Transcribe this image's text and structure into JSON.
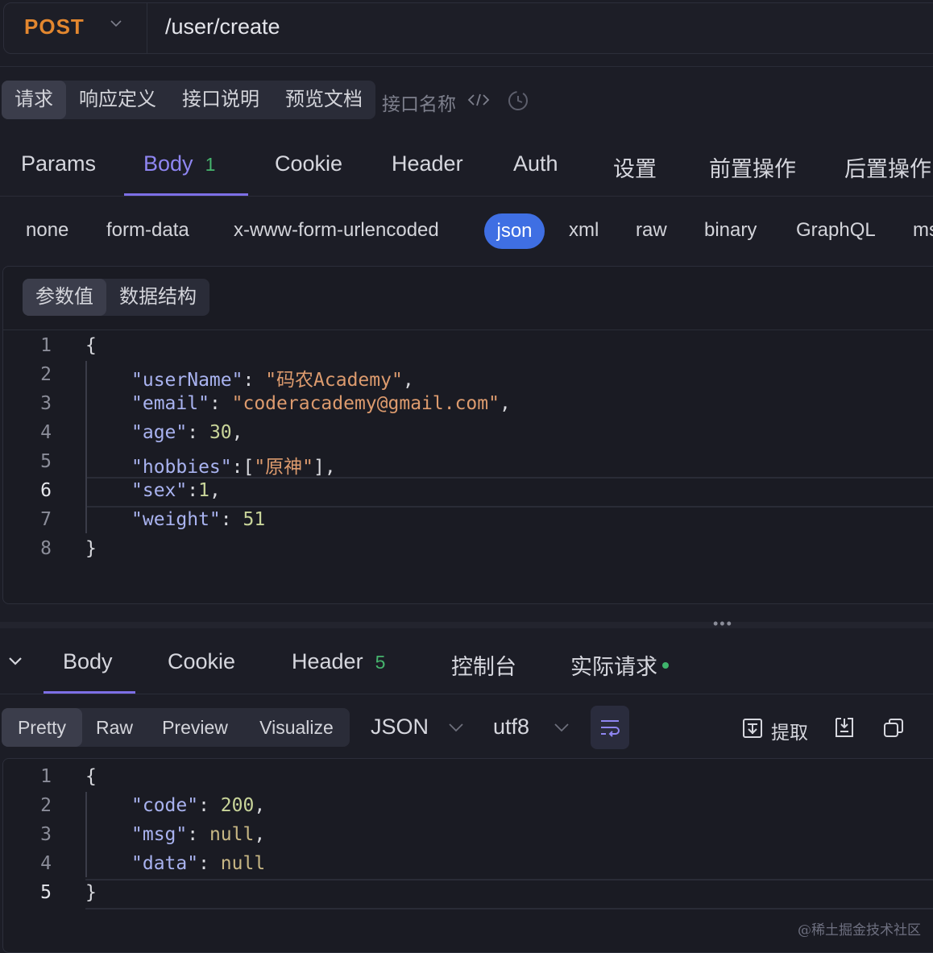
{
  "request": {
    "method": "POST",
    "url": "/user/create"
  },
  "top_tabs": [
    "请求",
    "响应定义",
    "接口说明",
    "预览文档"
  ],
  "api_name_placeholder": "接口名称",
  "request_tabs": {
    "params": "Params",
    "body": "Body",
    "body_count": "1",
    "cookie": "Cookie",
    "header": "Header",
    "auth": "Auth",
    "settings": "设置",
    "pre_ops": "前置操作",
    "post_ops": "后置操作"
  },
  "body_types": {
    "none": "none",
    "form_data": "form-data",
    "urlencoded": "x-www-form-urlencoded",
    "json": "json",
    "xml": "xml",
    "raw": "raw",
    "binary": "binary",
    "graphql": "GraphQL",
    "more": "ms"
  },
  "body_view": {
    "values": "参数值",
    "schema": "数据结构"
  },
  "request_code": {
    "line_numbers": [
      "1",
      "2",
      "3",
      "4",
      "5",
      "6",
      "7",
      "8"
    ],
    "l1": "{",
    "k2": "\"userName\"",
    "v2": "\"码农Academy\"",
    "k3": "\"email\"",
    "v3": "\"coderacademy@gmail.com\"",
    "k4": "\"age\"",
    "v4": "30",
    "k5": "\"hobbies\"",
    "v5": "\"原神\"",
    "k6": "\"sex\"",
    "v6": "1",
    "k7": "\"weight\"",
    "v7": "51",
    "l8": "}"
  },
  "response_tabs": {
    "body": "Body",
    "cookie": "Cookie",
    "header": "Header",
    "header_count": "5",
    "console": "控制台",
    "actual": "实际请求"
  },
  "response_view": {
    "pretty": "Pretty",
    "raw": "Raw",
    "preview": "Preview",
    "visualize": "Visualize",
    "format": "JSON",
    "encoding": "utf8",
    "extract": "提取"
  },
  "response_code": {
    "line_numbers": [
      "1",
      "2",
      "3",
      "4",
      "5"
    ],
    "l1": "{",
    "k2": "\"code\"",
    "v2": "200",
    "k3": "\"msg\"",
    "v3": "null",
    "k4": "\"data\"",
    "v4": "null",
    "l5": "}"
  },
  "watermark": "@稀土掘金技术社区",
  "colors": {
    "background": "#1c1d26",
    "method": "#e3872f",
    "accent": "#8f86f2",
    "json_pill": "#3f6fe3",
    "badge_green": "#46b46d"
  }
}
